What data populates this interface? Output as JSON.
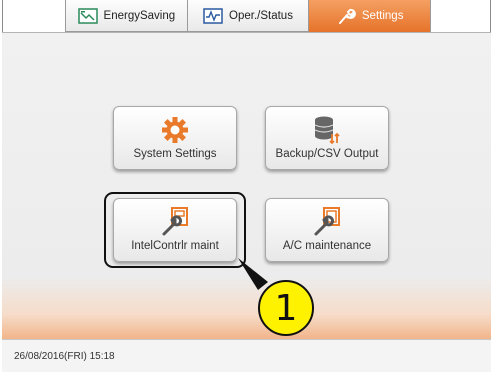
{
  "tabs": [
    {
      "label": "EnergySaving",
      "icon": "energy-chart-icon",
      "active": false
    },
    {
      "label": "Oper./Status",
      "icon": "waveform-icon",
      "active": false
    },
    {
      "label": "Settings",
      "icon": "wrench-icon",
      "active": true
    }
  ],
  "buttons": {
    "system_settings": {
      "label": "System Settings",
      "icon": "gear-icon"
    },
    "backup_csv": {
      "label": "Backup/CSV Output",
      "icon": "database-transfer-icon"
    },
    "intel_controller": {
      "label": "IntelContrlr maint",
      "icon": "controller-maintenance-icon"
    },
    "ac_maintenance": {
      "label": "A/C maintenance",
      "icon": "ac-maintenance-icon"
    }
  },
  "callout": {
    "number": "1"
  },
  "status": {
    "datetime": "26/08/2016(FRI) 15:18"
  },
  "colors": {
    "accent": "#e6732a",
    "callout_fill": "#fff200",
    "icon_orange": "#e87a2a"
  }
}
